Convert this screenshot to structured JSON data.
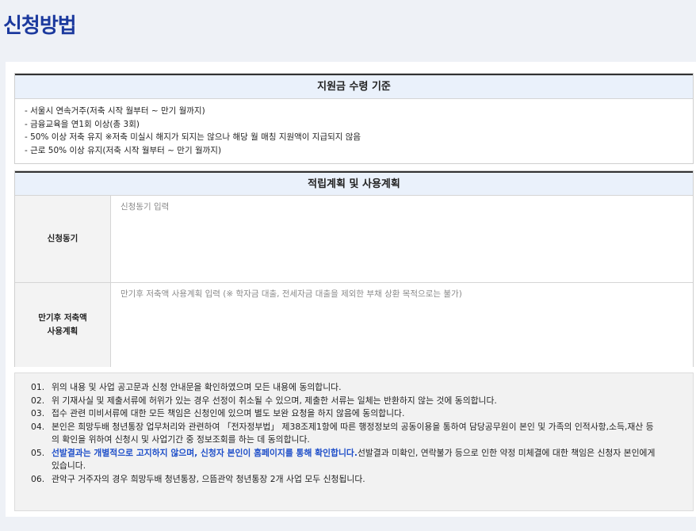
{
  "page": {
    "title": "신청방법"
  },
  "criteria": {
    "heading": "지원금 수령 기준",
    "items": [
      "- 서울시 연속거주(저축 시작 월부터 ~ 만기 월까지)",
      "- 금융교육을 연1회 이상(총 3회)",
      "- 50% 이상 저축 유지 ※저축 미실시 해지가 되지는 않으나 해당 월 매칭 지원액이 지급되지 않음",
      "- 근로 50% 이상 유지(저축 시작 월부터 ~ 만기 월까지)"
    ]
  },
  "plan": {
    "heading": "적립계획 및 사용계획",
    "motive": {
      "label": "신청동기",
      "placeholder": "신청동기 입력"
    },
    "usage": {
      "label": "만기후 저축액\n사용계획",
      "placeholder": "만기후 저축액 사용계획 입력 (※ 학자금 대출, 전세자금 대출을 제외한 부채 상환 목적으로는 불가)"
    }
  },
  "agreements": {
    "items": [
      {
        "num": "01.",
        "text": "위의 내용 및 사업 공고문과 신청 안내문을 확인하였으며 모든 내용에 동의합니다."
      },
      {
        "num": "02.",
        "text": "위 기재사실 및 제출서류에 허위가 있는 경우 선정이 취소될 수 있으며, 제출한 서류는 일체는 반환하지 않는 것에 동의합니다."
      },
      {
        "num": "03.",
        "text": "접수 관련 미비서류에 대한 모든 책임은 신청인에 있으며 별도 보완 요청을 하지 않음에 동의합니다."
      },
      {
        "num": "04.",
        "text": "본인은 희망두배 청년통장 업무처리와 관련하여 「전자정부법」 제38조제1항에 따른 행정정보의 공동이용을 통하여 담당공무원이 본인 및 가족의 인적사항,소득,재산 등의 확인을 위하여 신청시 및 사업기간 중 정보조회를 하는 데 동의합니다."
      },
      {
        "num": "05.",
        "highlight": "선발결과는 개별적으로 고지하지 않으며, 신청자 본인이 홈페이지를 통해 확인합니다.",
        "text": "선발결과 미확인, 연락불가 등으로 인한 약정 미체결에 대한 책임은 신청자 본인에게 있습니다."
      },
      {
        "num": "06.",
        "text": "관악구 거주자의 경우 희망두배 청년통장, 으뜸관악 청년통장 2개 사업 모두 신청됩니다."
      }
    ]
  }
}
